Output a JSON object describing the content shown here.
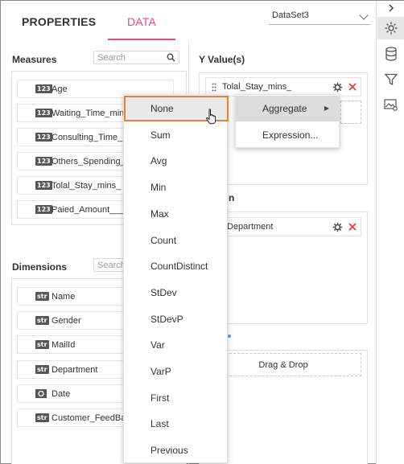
{
  "tabs": {
    "properties": "PROPERTIES",
    "data": "DATA"
  },
  "dataset": {
    "selected": "DataSet3"
  },
  "measures": {
    "title": "Measures",
    "search_placeholder": "Search",
    "items": [
      {
        "badge": "123",
        "label": "Age"
      },
      {
        "badge": "123",
        "label": "Waiting_Time_mins"
      },
      {
        "badge": "123",
        "label": "Consulting_Time_mins"
      },
      {
        "badge": "123",
        "label": "Others_Spending_mins"
      },
      {
        "badge": "123",
        "label": "Tolal_Stay_mins_"
      },
      {
        "badge": "123",
        "label": "Paied_Amount___"
      }
    ]
  },
  "dimensions": {
    "title": "Dimensions",
    "search_placeholder": "Search",
    "items": [
      {
        "badge": "str",
        "label": "Name"
      },
      {
        "badge": "str",
        "label": "Gender"
      },
      {
        "badge": "str",
        "label": "MailId"
      },
      {
        "badge": "str",
        "label": "Department"
      },
      {
        "badge": "date",
        "label": "Date"
      },
      {
        "badge": "str",
        "label": "Customer_FeedBack"
      }
    ]
  },
  "y_values": {
    "title": "Y Value(s)",
    "field": "Tolal_Stay_mins_"
  },
  "column": {
    "title_fragment": "n",
    "field": "Department"
  },
  "drop_area": {
    "label": "Drag & Drop"
  },
  "aggregate_menu": {
    "items": [
      "None",
      "Sum",
      "Avg",
      "Min",
      "Max",
      "Count",
      "CountDistinct",
      "StDev",
      "StDevP",
      "Var",
      "VarP",
      "First",
      "Last",
      "Previous"
    ],
    "selected": "None"
  },
  "context_menu": {
    "items": [
      {
        "label": "Aggregate",
        "has_submenu": true
      },
      {
        "label": "Expression...",
        "has_submenu": false
      }
    ]
  },
  "rail": {
    "collapse_icon": "chevron-right-icon",
    "icons": [
      "gear-icon",
      "database-icon",
      "filter-icon",
      "image-settings-icon"
    ]
  },
  "colors": {
    "accent": "#e94b78",
    "selection_border": "#ee7d3b",
    "delete": "#e53935"
  }
}
